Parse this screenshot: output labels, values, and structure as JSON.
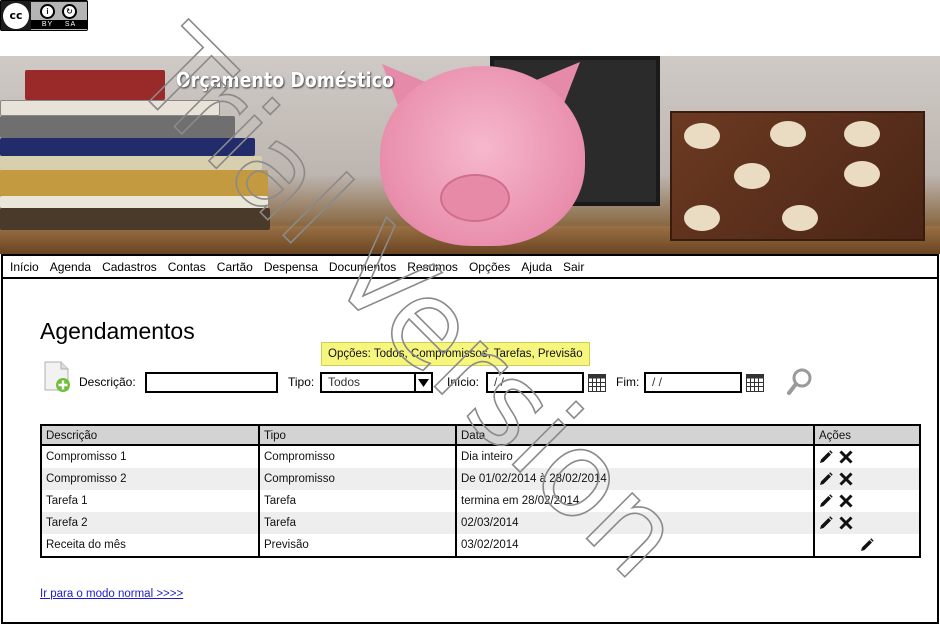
{
  "license_badge": {
    "cc_text": "cc",
    "by_text": "BY",
    "sa_text": "SA"
  },
  "banner": {
    "title": "Orçamento Doméstico"
  },
  "nav": {
    "items": [
      "Início",
      "Agenda",
      "Cadastros",
      "Contas",
      "Cartão",
      "Despensa",
      "Documentos",
      "Resumos",
      "Opções",
      "Ajuda",
      "Sair"
    ]
  },
  "page": {
    "title": "Agendamentos"
  },
  "tooltip": {
    "text": "Opções: Todos, Compromissos, Tarefas, Previsão"
  },
  "filters": {
    "descricao_label": "Descrição:",
    "descricao_value": "",
    "tipo_label": "Tipo:",
    "tipo_value": "Todos",
    "inicio_label": "Início:",
    "inicio_value": " /  /",
    "fim_label": "Fim:",
    "fim_value": " /  /"
  },
  "table": {
    "headers": [
      "Descrição",
      "Tipo",
      "Data",
      "Ações"
    ],
    "rows": [
      {
        "descricao": "Compromisso 1",
        "tipo": "Compromisso",
        "data": "Dia inteiro",
        "actions": [
          "edit",
          "delete"
        ]
      },
      {
        "descricao": "Compromisso 2",
        "tipo": "Compromisso",
        "data": "De 01/02/2014 à 28/02/2014",
        "actions": [
          "edit",
          "delete"
        ]
      },
      {
        "descricao": "Tarefa 1",
        "tipo": "Tarefa",
        "data": "termina em 28/02/2014",
        "actions": [
          "edit",
          "delete"
        ]
      },
      {
        "descricao": "Tarefa 2",
        "tipo": "Tarefa",
        "data": "02/03/2014",
        "actions": [
          "edit",
          "delete"
        ]
      },
      {
        "descricao": "Receita do mês",
        "tipo": "Previsão",
        "data": "03/02/2014",
        "actions": [
          "edit"
        ]
      }
    ]
  },
  "footer": {
    "normal_mode_link": "Ir para o modo normal >>>>"
  },
  "watermark": {
    "text": "Trial Version"
  },
  "icons": {
    "new": "new-document-icon",
    "calendar": "calendar-icon",
    "search": "search-icon",
    "edit": "pencil-icon",
    "delete": "close-icon"
  },
  "colors": {
    "tooltip_bg": "#f6f67e",
    "header_bg": "#d3d3d3",
    "link": "#1d1dcc",
    "pig": "#e98fad"
  }
}
